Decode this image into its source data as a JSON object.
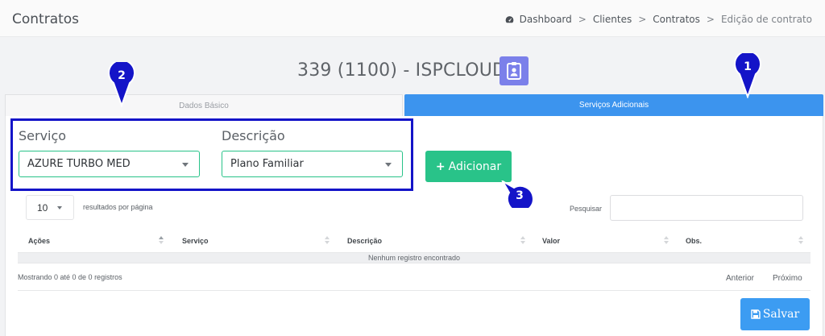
{
  "header": {
    "title": "Contratos",
    "breadcrumb": [
      "Dashboard",
      "Clientes",
      "Contratos",
      "Edição de contrato"
    ],
    "breadcrumb_icon": "dashboard-icon"
  },
  "contract": {
    "title": "339 (1100) - ISPCLOUD",
    "badge_icon": "contact-card-icon",
    "badge_color": "#7b80ea"
  },
  "tabs": {
    "basic": "Dados Básico",
    "services": "Serviços Adicionais",
    "active": "services",
    "active_color": "#3c94ee"
  },
  "form": {
    "service_label": "Serviço",
    "service_value": "AZURE TURBO MED",
    "description_label": "Descrição",
    "description_value": "Plano Familiar",
    "add_button": "Adicionar",
    "add_color": "#29c389"
  },
  "table": {
    "page_size": "10",
    "page_size_label": "resultados por página",
    "search_label": "Pesquisar",
    "columns": [
      "Ações",
      "Serviço",
      "Descrição",
      "Valor",
      "Obs."
    ],
    "empty_message": "Nenhum registro encontrado",
    "info": "Mostrando 0 até 0 de 0 registros",
    "prev": "Anterior",
    "next": "Próximo"
  },
  "save_button": "Salvar",
  "save_color": "#3c9cf2",
  "annotations": [
    "1",
    "2",
    "3"
  ],
  "annotation_color": "#1414c8"
}
